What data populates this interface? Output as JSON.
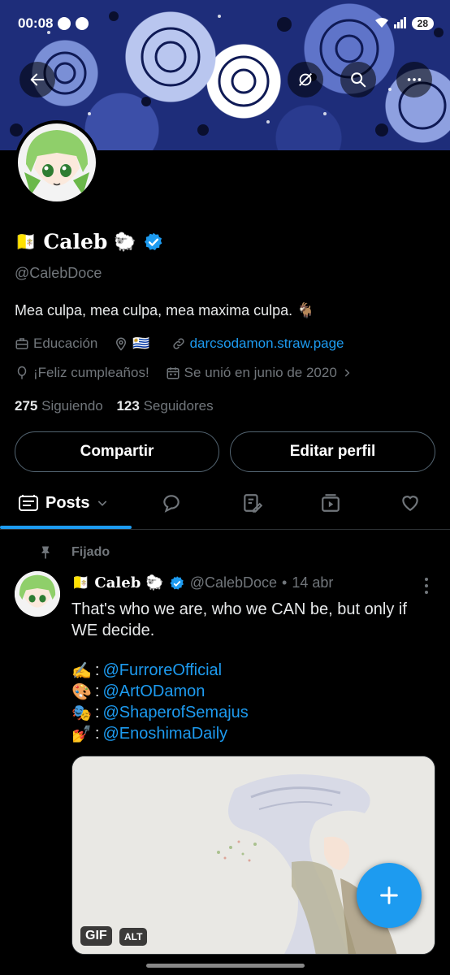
{
  "status_bar": {
    "time": "00:08",
    "battery": "28"
  },
  "profile": {
    "flag": "🇻🇦",
    "name": "Caleb",
    "name_emoji": "🐑",
    "handle": "@CalebDoce",
    "bio": "Mea culpa, mea culpa, mea maxima culpa. 🐐",
    "category": "Educación",
    "location_flag": "🇺🇾",
    "website": "darcsodamon.straw.page",
    "birthday": "¡Feliz cumpleaños!",
    "joined": "Se unió en junio de 2020",
    "following_count": "275",
    "following_label": "Siguiendo",
    "followers_count": "123",
    "followers_label": "Seguidores"
  },
  "buttons": {
    "share": "Compartir",
    "edit": "Editar perfil"
  },
  "tabs": {
    "posts": "Posts"
  },
  "pinned_label": "Fijado",
  "post": {
    "flag": "🇻🇦",
    "name": "Caleb",
    "name_emoji": "🐑",
    "handle": "@CalebDoce",
    "separator": "•",
    "date": "14 abr",
    "text": "That's who we are, who we CAN be, but only if WE decide.",
    "credits": [
      {
        "emoji": "✍️",
        "mention": "@FurroreOfficial"
      },
      {
        "emoji": "🎨",
        "mention": "@ArtODamon"
      },
      {
        "emoji": "🎭",
        "mention": "@ShaperofSemajus"
      },
      {
        "emoji": "💅",
        "mention": "@EnoshimaDaily"
      }
    ],
    "colon": ":",
    "media_badges": {
      "gif": "GIF",
      "alt": "ALT"
    }
  },
  "colors": {
    "accent": "#1d9bf0",
    "background": "#000000",
    "muted": "#71767b"
  },
  "icons": [
    "back-arrow-icon",
    "no-notifications-icon",
    "search-icon",
    "more-icon",
    "verified-icon",
    "briefcase-icon",
    "location-icon",
    "link-icon",
    "balloon-icon",
    "calendar-icon",
    "chevron-right-icon",
    "posts-icon",
    "replies-icon",
    "highlights-icon",
    "media-icon",
    "likes-icon",
    "pin-icon",
    "compose-plus-icon"
  ]
}
